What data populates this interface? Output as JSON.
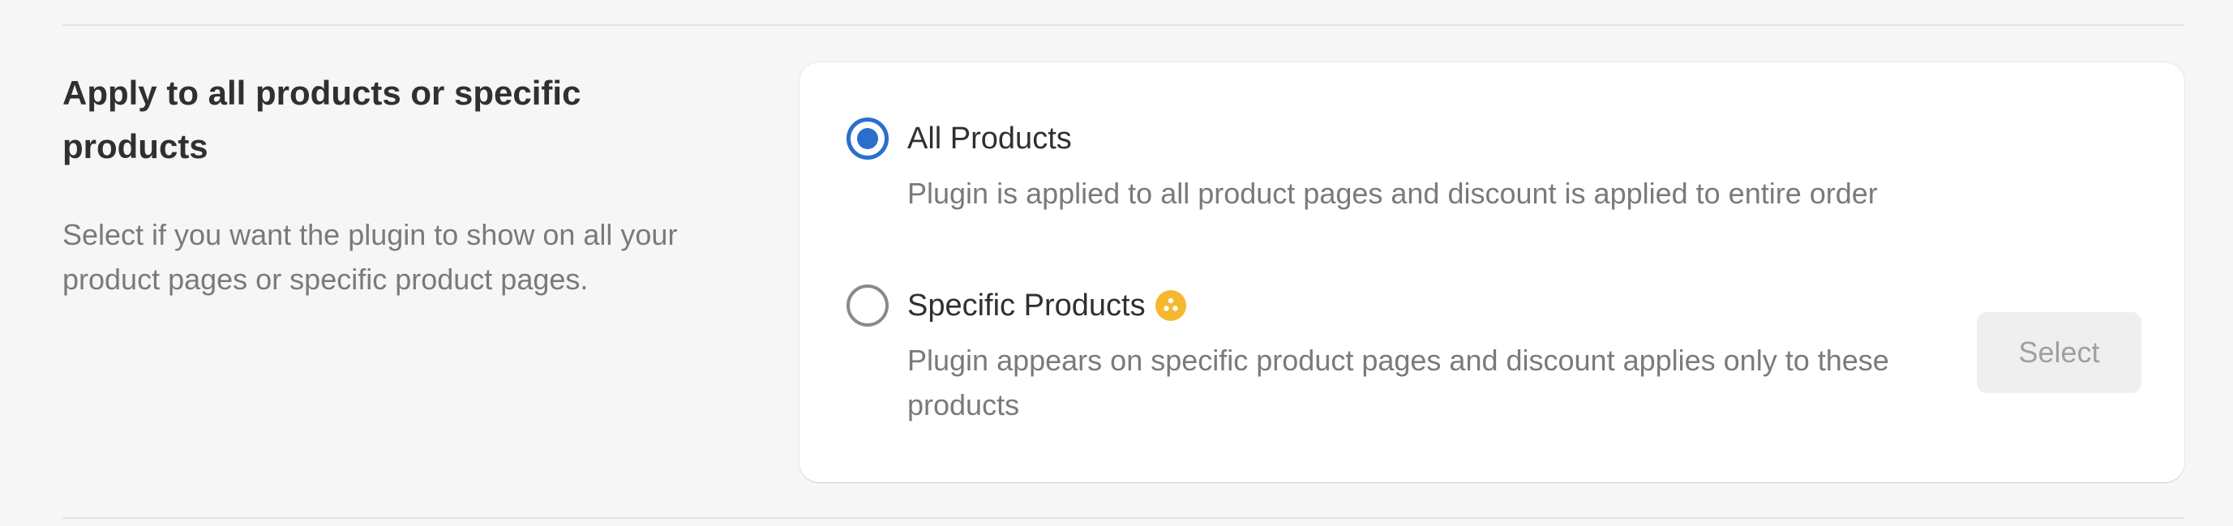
{
  "section": {
    "title": "Apply to all products or specific products",
    "description": "Select if you want the plugin to show on all your product pages or specific product pages."
  },
  "options": [
    {
      "label": "All Products",
      "help": "Plugin is applied to all product pages and discount is applied to entire order",
      "selected": true
    },
    {
      "label": "Specific Products",
      "help": "Plugin appears on specific product pages and discount applies only to these products",
      "selected": false,
      "badge_icon": "premium-icon",
      "badge_color": "#f5b82e"
    }
  ],
  "select_button": {
    "label": "Select",
    "disabled": true
  },
  "colors": {
    "accent": "#2c6ecb",
    "background": "#f6f6f6",
    "card": "#ffffff"
  }
}
